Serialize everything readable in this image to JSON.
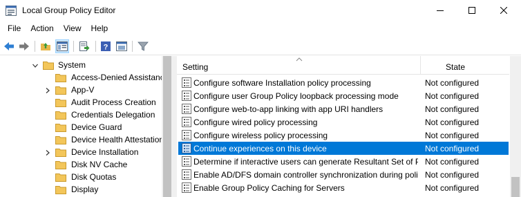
{
  "window": {
    "title": "Local Group Policy Editor"
  },
  "menu": {
    "items": [
      "File",
      "Action",
      "View",
      "Help"
    ]
  },
  "tree": {
    "items": [
      {
        "label": "System",
        "expanded": true,
        "level": 0
      },
      {
        "label": "Access-Denied Assistance",
        "level": 1,
        "has_children": false
      },
      {
        "label": "App-V",
        "level": 1,
        "has_children": true
      },
      {
        "label": "Audit Process Creation",
        "level": 1,
        "has_children": false
      },
      {
        "label": "Credentials Delegation",
        "level": 1,
        "has_children": false
      },
      {
        "label": "Device Guard",
        "level": 1,
        "has_children": false
      },
      {
        "label": "Device Health Attestation Service",
        "level": 1,
        "has_children": false
      },
      {
        "label": "Device Installation",
        "level": 1,
        "has_children": true
      },
      {
        "label": "Disk NV Cache",
        "level": 1,
        "has_children": false
      },
      {
        "label": "Disk Quotas",
        "level": 1,
        "has_children": false
      },
      {
        "label": "Display",
        "level": 1,
        "has_children": false
      }
    ]
  },
  "list": {
    "columns": {
      "setting": "Setting",
      "state": "State"
    },
    "rows": [
      {
        "setting": "Configure software Installation policy processing",
        "state": "Not configured"
      },
      {
        "setting": "Configure user Group Policy loopback processing mode",
        "state": "Not configured"
      },
      {
        "setting": "Configure web-to-app linking with app URI handlers",
        "state": "Not configured"
      },
      {
        "setting": "Configure wired policy processing",
        "state": "Not configured"
      },
      {
        "setting": "Configure wireless policy processing",
        "state": "Not configured"
      },
      {
        "setting": "Continue experiences on this device",
        "state": "Not configured",
        "selected": true
      },
      {
        "setting": "Determine if interactive users can generate Resultant Set of Policy data",
        "state": "Not configured"
      },
      {
        "setting": "Enable AD/DFS domain controller synchronization during policy refresh",
        "state": "Not configured"
      },
      {
        "setting": "Enable Group Policy Caching for Servers",
        "state": "Not configured"
      }
    ]
  },
  "colors": {
    "selection": "#0078d7",
    "folder": "#e8b84a",
    "back_arrow": "#2e7fd3"
  }
}
